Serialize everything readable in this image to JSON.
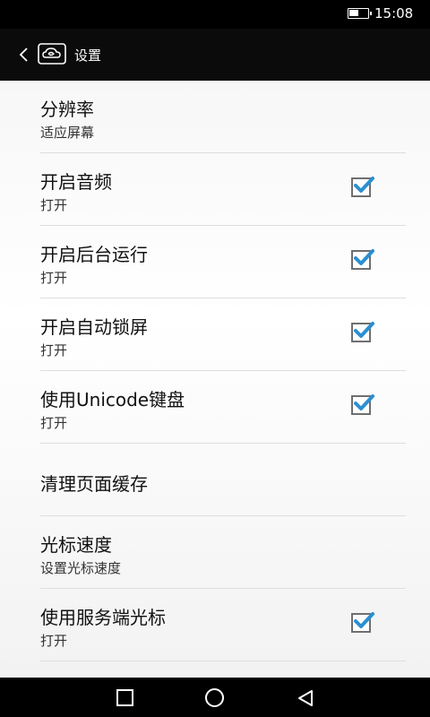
{
  "status_bar": {
    "time": "15:08",
    "battery_icon": "battery-icon"
  },
  "app_bar": {
    "title": "设置",
    "back_icon": "back-arrow-icon",
    "logo_icon": "cloud-app-icon"
  },
  "settings": [
    {
      "title": "分辨率",
      "subtitle": "适应屏幕",
      "checkbox": false
    },
    {
      "title": "开启音频",
      "subtitle": "打开",
      "checkbox": true,
      "checked": true
    },
    {
      "title": "开启后台运行",
      "subtitle": "打开",
      "checkbox": true,
      "checked": true
    },
    {
      "title": "开启自动锁屏",
      "subtitle": "打开",
      "checkbox": true,
      "checked": true
    },
    {
      "title": "使用Unicode键盘",
      "subtitle": "打开",
      "checkbox": true,
      "checked": true
    },
    {
      "title": "清理页面缓存",
      "subtitle": "",
      "checkbox": false
    },
    {
      "title": "光标速度",
      "subtitle": "设置光标速度",
      "checkbox": false
    },
    {
      "title": "使用服务端光标",
      "subtitle": "打开",
      "checkbox": true,
      "checked": true
    }
  ],
  "nav_bar": {
    "recent_icon": "recent-apps-icon",
    "home_icon": "home-icon",
    "back_icon": "back-triangle-icon"
  },
  "colors": {
    "check_accent": "#2b8fd1",
    "app_bar": "#0b0b0b"
  }
}
